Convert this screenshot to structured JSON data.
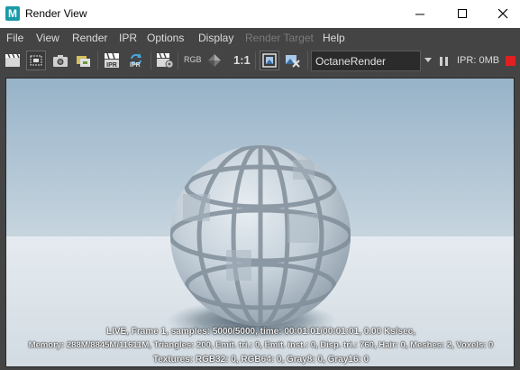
{
  "window": {
    "title": "Render View",
    "logo": "M"
  },
  "menu": [
    "File",
    "View",
    "Render",
    "IPR",
    "Options",
    "Display",
    "Render Target",
    "Help"
  ],
  "toolbar": {
    "rgb_label": "RGB",
    "ratio_label": "1:1",
    "ipr_label": "IPR",
    "renderer": "OctaneRender",
    "ipr_memory": "IPR: 0MB",
    "icons": [
      "clapper-icon",
      "render-region-icon",
      "snapshot-icon",
      "keep-image-icon",
      "ipr-render-icon",
      "refresh-ipr-icon",
      "render-settings-icon",
      "channel-icon",
      "one-to-one-icon",
      "display-frame-icon",
      "remove-image-icon",
      "pause-icon",
      "stop-icon"
    ],
    "stop_color": "#e02020"
  },
  "status": {
    "line1": "LIVE, Frame 1, samples: 5000/5000, time: 00:01:01/00:01:01, 0.00 Ks/sec,",
    "line2": "Memory: 288M/8845M/11611M, Triangles: 200, Emit. tri.: 0, Emit. inst.: 0, Disp. tri.: 760, Hair: 0, Meshes: 2, Voxels: 0",
    "line3": "Textures: RGB32: 0, RGB64: 0, Gray8: 0, Gray16: 0"
  }
}
